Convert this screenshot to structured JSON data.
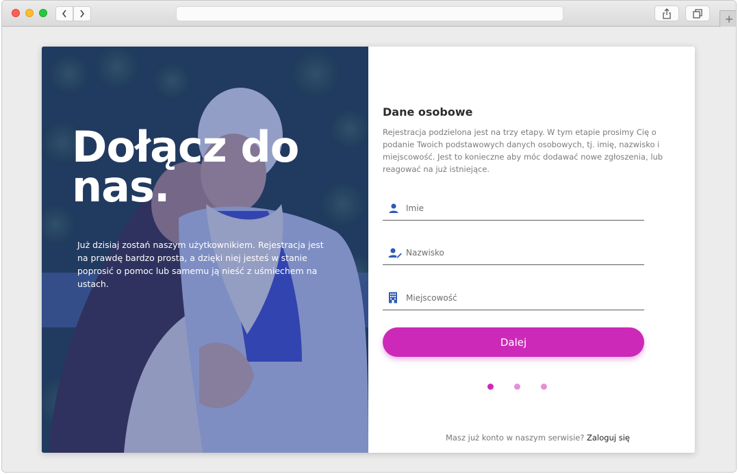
{
  "browser": {
    "url": ""
  },
  "hero": {
    "title": "Dołącz do nas.",
    "text": "Już dzisiaj zostań naszym użytkownikiem. Rejestracja jest na prawdę bardzo prosta, a dzięki niej jesteś w stanie poprosić o pomoc lub samemu ją nieść z uśmiechem na ustach.",
    "overlay_color": "#2d3f86"
  },
  "form": {
    "title": "Dane osobowe",
    "description": "Rejestracja podzielona jest na trzy etapy. W tym etapie prosimy Cię o podanie Twoich podstawowych danych osobowych, tj. imię, nazwisko i miejscowość. Jest to konieczne aby móc dodawać nowe zgłoszenia, lub reagować na już istniejące.",
    "fields": [
      {
        "icon": "user-icon",
        "placeholder": "Imie",
        "value": ""
      },
      {
        "icon": "user-edit-icon",
        "placeholder": "Nazwisko",
        "value": ""
      },
      {
        "icon": "building-icon",
        "placeholder": "Miejscowość",
        "value": ""
      }
    ],
    "submit_label": "Dalej",
    "steps": {
      "current": 1,
      "total": 3
    },
    "footer_text": "Masz już konto w naszym serwisie?",
    "footer_link": "Zaloguj się"
  },
  "colors": {
    "accent": "#cc29b9",
    "icon": "#2d5bb5"
  }
}
